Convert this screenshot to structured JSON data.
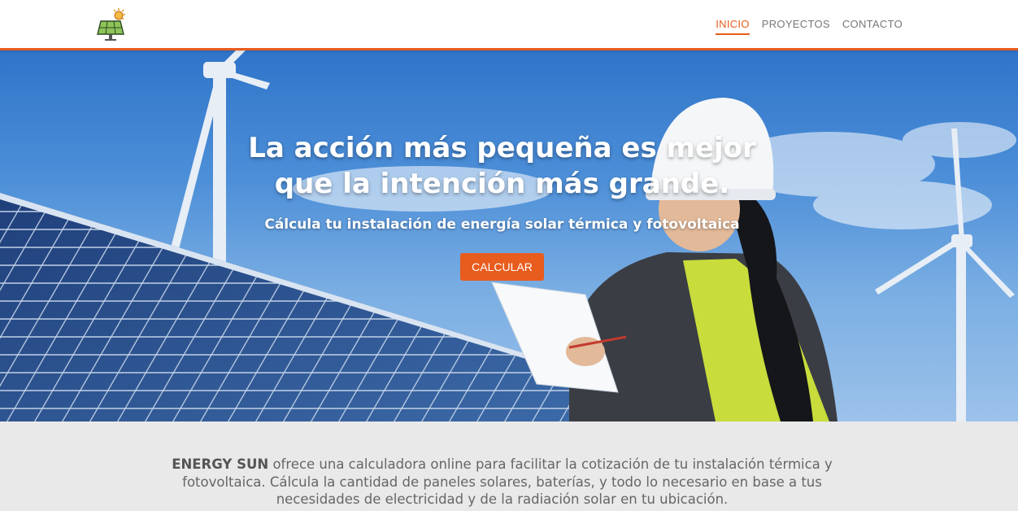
{
  "header": {
    "logo_icon": "solar-panel-sun-icon",
    "nav": [
      {
        "label": "INICIO",
        "active": true
      },
      {
        "label": "PROYECTOS",
        "active": false
      },
      {
        "label": "CONTACTO",
        "active": false
      }
    ]
  },
  "hero": {
    "title_line1": "La acción más pequeña es mejor",
    "title_line2": "que la intención más grande.",
    "subtitle": "Cálcula tu instalación de energía solar térmica y fotovoltaica",
    "button_label": "CALCULAR"
  },
  "about": {
    "brand": "ENERGY SUN",
    "text": " ofrece una calculadora online para facilitar la cotización de tu instalación térmica y fotovoltaica. Cálcula la cantidad de paneles solares, baterías, y todo lo necesario en base a tus necesidades de electricidad y de la radiación solar en tu ubicación."
  },
  "colors": {
    "accent": "#e85c1e",
    "about_bg": "#e9e9e9",
    "nav_text": "#777777"
  }
}
